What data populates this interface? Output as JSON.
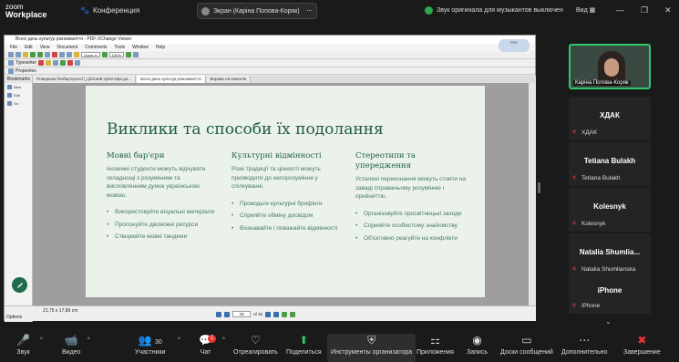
{
  "zoom": {
    "brand_line1": "zoom",
    "brand_line2": "Workplace",
    "conference_label": "Конференция",
    "screen_label": "Экран (Каріна Попова-Коряк)",
    "original_sound_label": "Звук оригинала для музыкантов выключен",
    "view_label": "Вид"
  },
  "pdfxchange": {
    "window_title": "Всесі день культур різноманіття - PDF-XChange Viewer",
    "menu": [
      "File",
      "Edit",
      "View",
      "Document",
      "Comments",
      "Tools",
      "Window",
      "Help"
    ],
    "toolbar_labels": [
      "Typewriter",
      "Properties"
    ],
    "zoom_value": "Zoom In",
    "percent_value": "100%",
    "tabs": [
      "Поведінка безбар'єрності_цілісний орієнтири до...",
      "Всесі день культур різноманіття",
      "Вправа на емпатію"
    ],
    "side_header": "Bookmarks",
    "side_items": [
      "New",
      "Edit",
      "Go"
    ],
    "coords": "21,75 x 17,89 cm",
    "options_label": "Options",
    "page_current": "18",
    "page_total": "of 15"
  },
  "slide": {
    "title": "Виклики та способи їх подолання",
    "columns": [
      {
        "heading": "Мовні бар'єри",
        "body": "Іноземні студенти можуть відчувати складнощі з розумінням та висловленням думок українською мовою.",
        "bullets": [
          "Використовуйте візуальні матеріали",
          "Пропонуйте двомовні ресурси",
          "Створюйте мовні тандеми"
        ]
      },
      {
        "heading": "Культурні відмінності",
        "body": "Різні традиції та цінності можуть призводити до непорозуміння у спілкуванні.",
        "bullets": [
          "Проводьте культурні брифінги",
          "Сприяйте обміну досвідом",
          "Визнавайте і поважайте відмінності"
        ]
      },
      {
        "heading": "Стереотипи та упередження",
        "body": "Усталені переконання можуть стояти на заваді справжньому розумінню і прийняттю.",
        "bullets": [
          "Організовуйте просвітницькі заходи",
          "Сприяйте особистому знайомству",
          "Об'єктивно реагуйте на конфлікти"
        ]
      }
    ]
  },
  "participants": {
    "self_name": "Каріна Попова-Коряк",
    "list": [
      {
        "big": "ХДАК",
        "small": "ХДАК"
      },
      {
        "big": "Tetiana Bulakh",
        "small": "Tetiana Bulakh"
      },
      {
        "big": "Kolesnyk",
        "small": "Kolesnyk"
      },
      {
        "big": "Natalia Shumlia...",
        "small": "Natalia Shumlianska"
      },
      {
        "big": "iPhone",
        "small": "iPhone"
      }
    ]
  },
  "toolbar": {
    "audio": "Звук",
    "video": "Видео",
    "participants": "Участники",
    "participants_count": "30",
    "chat": "Чат",
    "chat_badge": "1",
    "react": "Отреагировать",
    "share": "Поделиться",
    "host_tools": "Инструменты организатора",
    "apps": "Приложения",
    "record": "Запись",
    "boards": "Доски сообщений",
    "more": "Дополнительно",
    "end": "Завершение"
  },
  "colors": {
    "slide_bg": "#eaf2ea",
    "slide_title": "#235b45",
    "active_speaker_border": "#2dc96a",
    "share_icon": "#2dc96a",
    "end_icon": "#e33333"
  }
}
